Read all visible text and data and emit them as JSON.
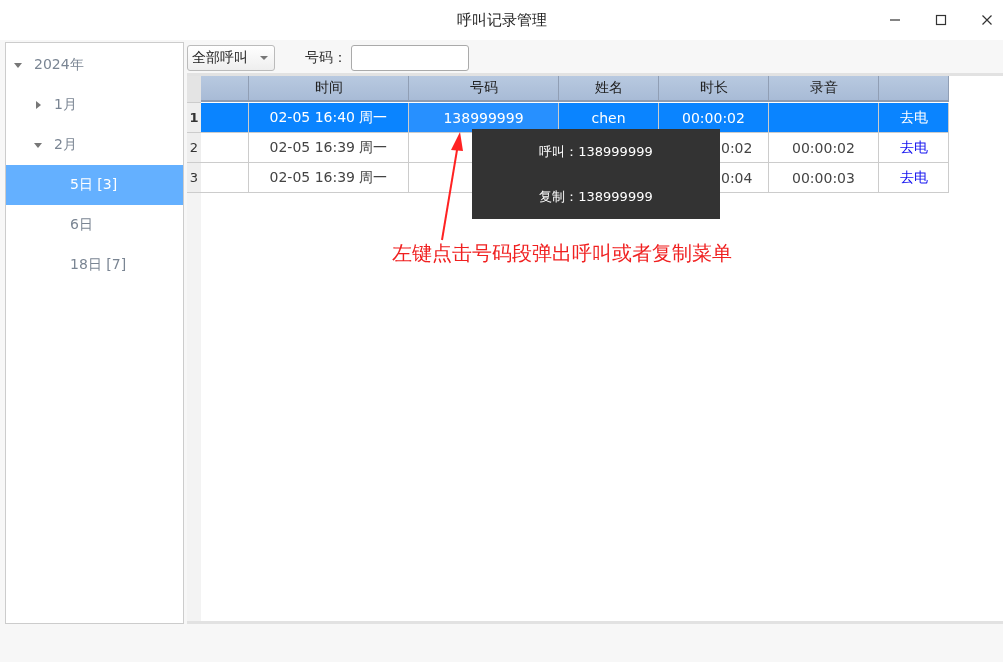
{
  "window": {
    "title": "呼叫记录管理"
  },
  "tree": [
    {
      "label": "2024年",
      "expanded": true,
      "selected": false,
      "children": [
        {
          "label": "1月",
          "expanded": false,
          "selected": false
        },
        {
          "label": "2月",
          "expanded": true,
          "selected": false,
          "children": [
            {
              "label": "5日 [3]",
              "selected": true
            },
            {
              "label": "6日",
              "selected": false
            },
            {
              "label": "18日 [7]",
              "selected": false
            }
          ]
        }
      ]
    }
  ],
  "toolbar": {
    "filter": "全部呼叫",
    "number_label": "号码："
  },
  "table": {
    "columns": [
      "",
      "时间",
      "号码",
      "姓名",
      "时长",
      "录音",
      ""
    ],
    "rows": [
      {
        "index": "1",
        "selected": true,
        "cells": [
          "",
          "02-05 16:40 周一",
          "138999999",
          "chen",
          "00:00:02",
          "",
          "去电"
        ]
      },
      {
        "index": "2",
        "selected": false,
        "cells": [
          "",
          "02-05 16:39 周一",
          "",
          "",
          "0:02",
          "00:00:02",
          "去电"
        ]
      },
      {
        "index": "3",
        "selected": false,
        "cells": [
          "",
          "02-05 16:39 周一",
          "",
          "",
          "0:04",
          "00:00:03",
          "去电"
        ]
      }
    ]
  },
  "popup_menu": [
    {
      "label": "呼叫：138999999"
    },
    {
      "label": "复制：138999999"
    }
  ],
  "annotation": "左键点击号码段弹出呼叫或者复制菜单"
}
